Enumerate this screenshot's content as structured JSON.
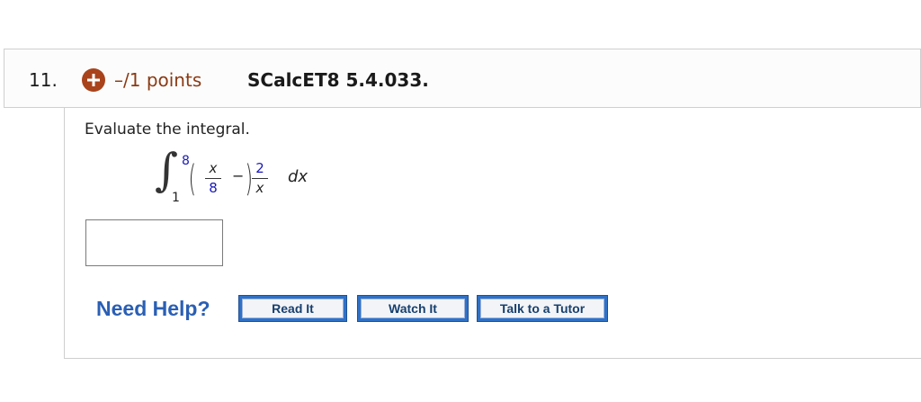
{
  "question": {
    "number": "11.",
    "points": "–/1 points",
    "source": "SCalcET8 5.4.033.",
    "prompt": "Evaluate the integral.",
    "integral": {
      "upper_limit": "8",
      "lower_limit": "1",
      "term1_numerator": "x",
      "term1_denominator": "8",
      "operator": "−",
      "term2_numerator": "2",
      "term2_denominator": "x",
      "differential": "dx"
    },
    "answer": {
      "value": "",
      "placeholder": ""
    }
  },
  "help": {
    "label": "Need Help?",
    "buttons": {
      "read": "Read It",
      "watch": "Watch It",
      "tutor": "Talk to a Tutor"
    }
  },
  "colors": {
    "points_accent": "#8a3a14",
    "plus_button": "#a8431c",
    "help_link": "#2a5fb4",
    "help_button_border": "#2f71c8",
    "math_blue": "#1a1ab8"
  },
  "icons": {
    "expand": "plus-circle-icon"
  }
}
